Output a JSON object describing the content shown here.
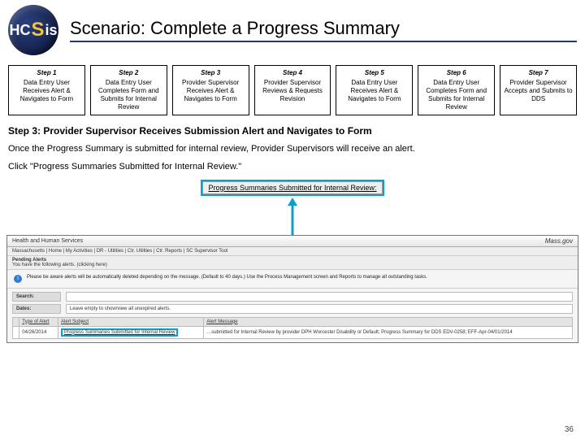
{
  "header": {
    "logo_text_1": "HC",
    "logo_text_2": "S",
    "logo_text_3": "is",
    "title": "Scenario: Complete a Progress Summary"
  },
  "steps": [
    {
      "num": "Step 1",
      "txt": "Data Entry User Receives Alert & Navigates to Form"
    },
    {
      "num": "Step 2",
      "txt": "Data Entry User Completes Form and Submits for Internal Review"
    },
    {
      "num": "Step 3",
      "txt": "Provider Supervisor Receives Alert & Navigates to Form"
    },
    {
      "num": "Step 4",
      "txt": "Provider Supervisor Reviews & Requests Revision"
    },
    {
      "num": "Step 5",
      "txt": "Data Entry User Receives Alert & Navigates to Form"
    },
    {
      "num": "Step 6",
      "txt": "Data Entry User Completes Form and Submits for Internal Review"
    },
    {
      "num": "Step 7",
      "txt": "Provider Supervisor Accepts and Submits to DDS"
    }
  ],
  "section_heading": "Step 3: Provider Supervisor Receives Submission Alert and Navigates to Form",
  "para1": "Once the Progress Summary is submitted for internal review, Provider Supervisors will receive an alert.",
  "para2": "Click \"Progress Summaries Submitted for Internal Review.\"",
  "link_label": "Progress Summaries Submitted for Internal Review:",
  "shot": {
    "top_left": "Health and Human Services",
    "brand": "Mass.gov",
    "breadcrumb": "Massachusetts | Home | My Activities | DR - Utilities | Ctr. Utilities | Ctr. Reports | SC Supervisor Tool",
    "pending_label": "Pending Alerts",
    "pending_sub": "You have the following alerts.  (clicking here)",
    "note": "Please be aware alerts will be automatically deleted depending on the message. (Default to 40 days.) Use the Process Management screen and Reports to manage all outstanding tasks.",
    "blocks": {
      "search_label": "Search:",
      "search_body": "",
      "dates_label": "Dates:",
      "dates_body": "Leave empty to show/view all unexpired alerts."
    },
    "cols": [
      "",
      "Type of Alert",
      "Alert Subject",
      "Alert Message"
    ],
    "row": {
      "c0": "",
      "c1": "04/26/2014",
      "c2_link": "Progress Summaries Submitted for Internal Review",
      "c3": "…submitted for Internal Review by provider DPH Worcester Disability or Default; Progress Summary for DDS EDV-0258; EFF-Apr-04/01/2014"
    }
  },
  "page_number": "36"
}
